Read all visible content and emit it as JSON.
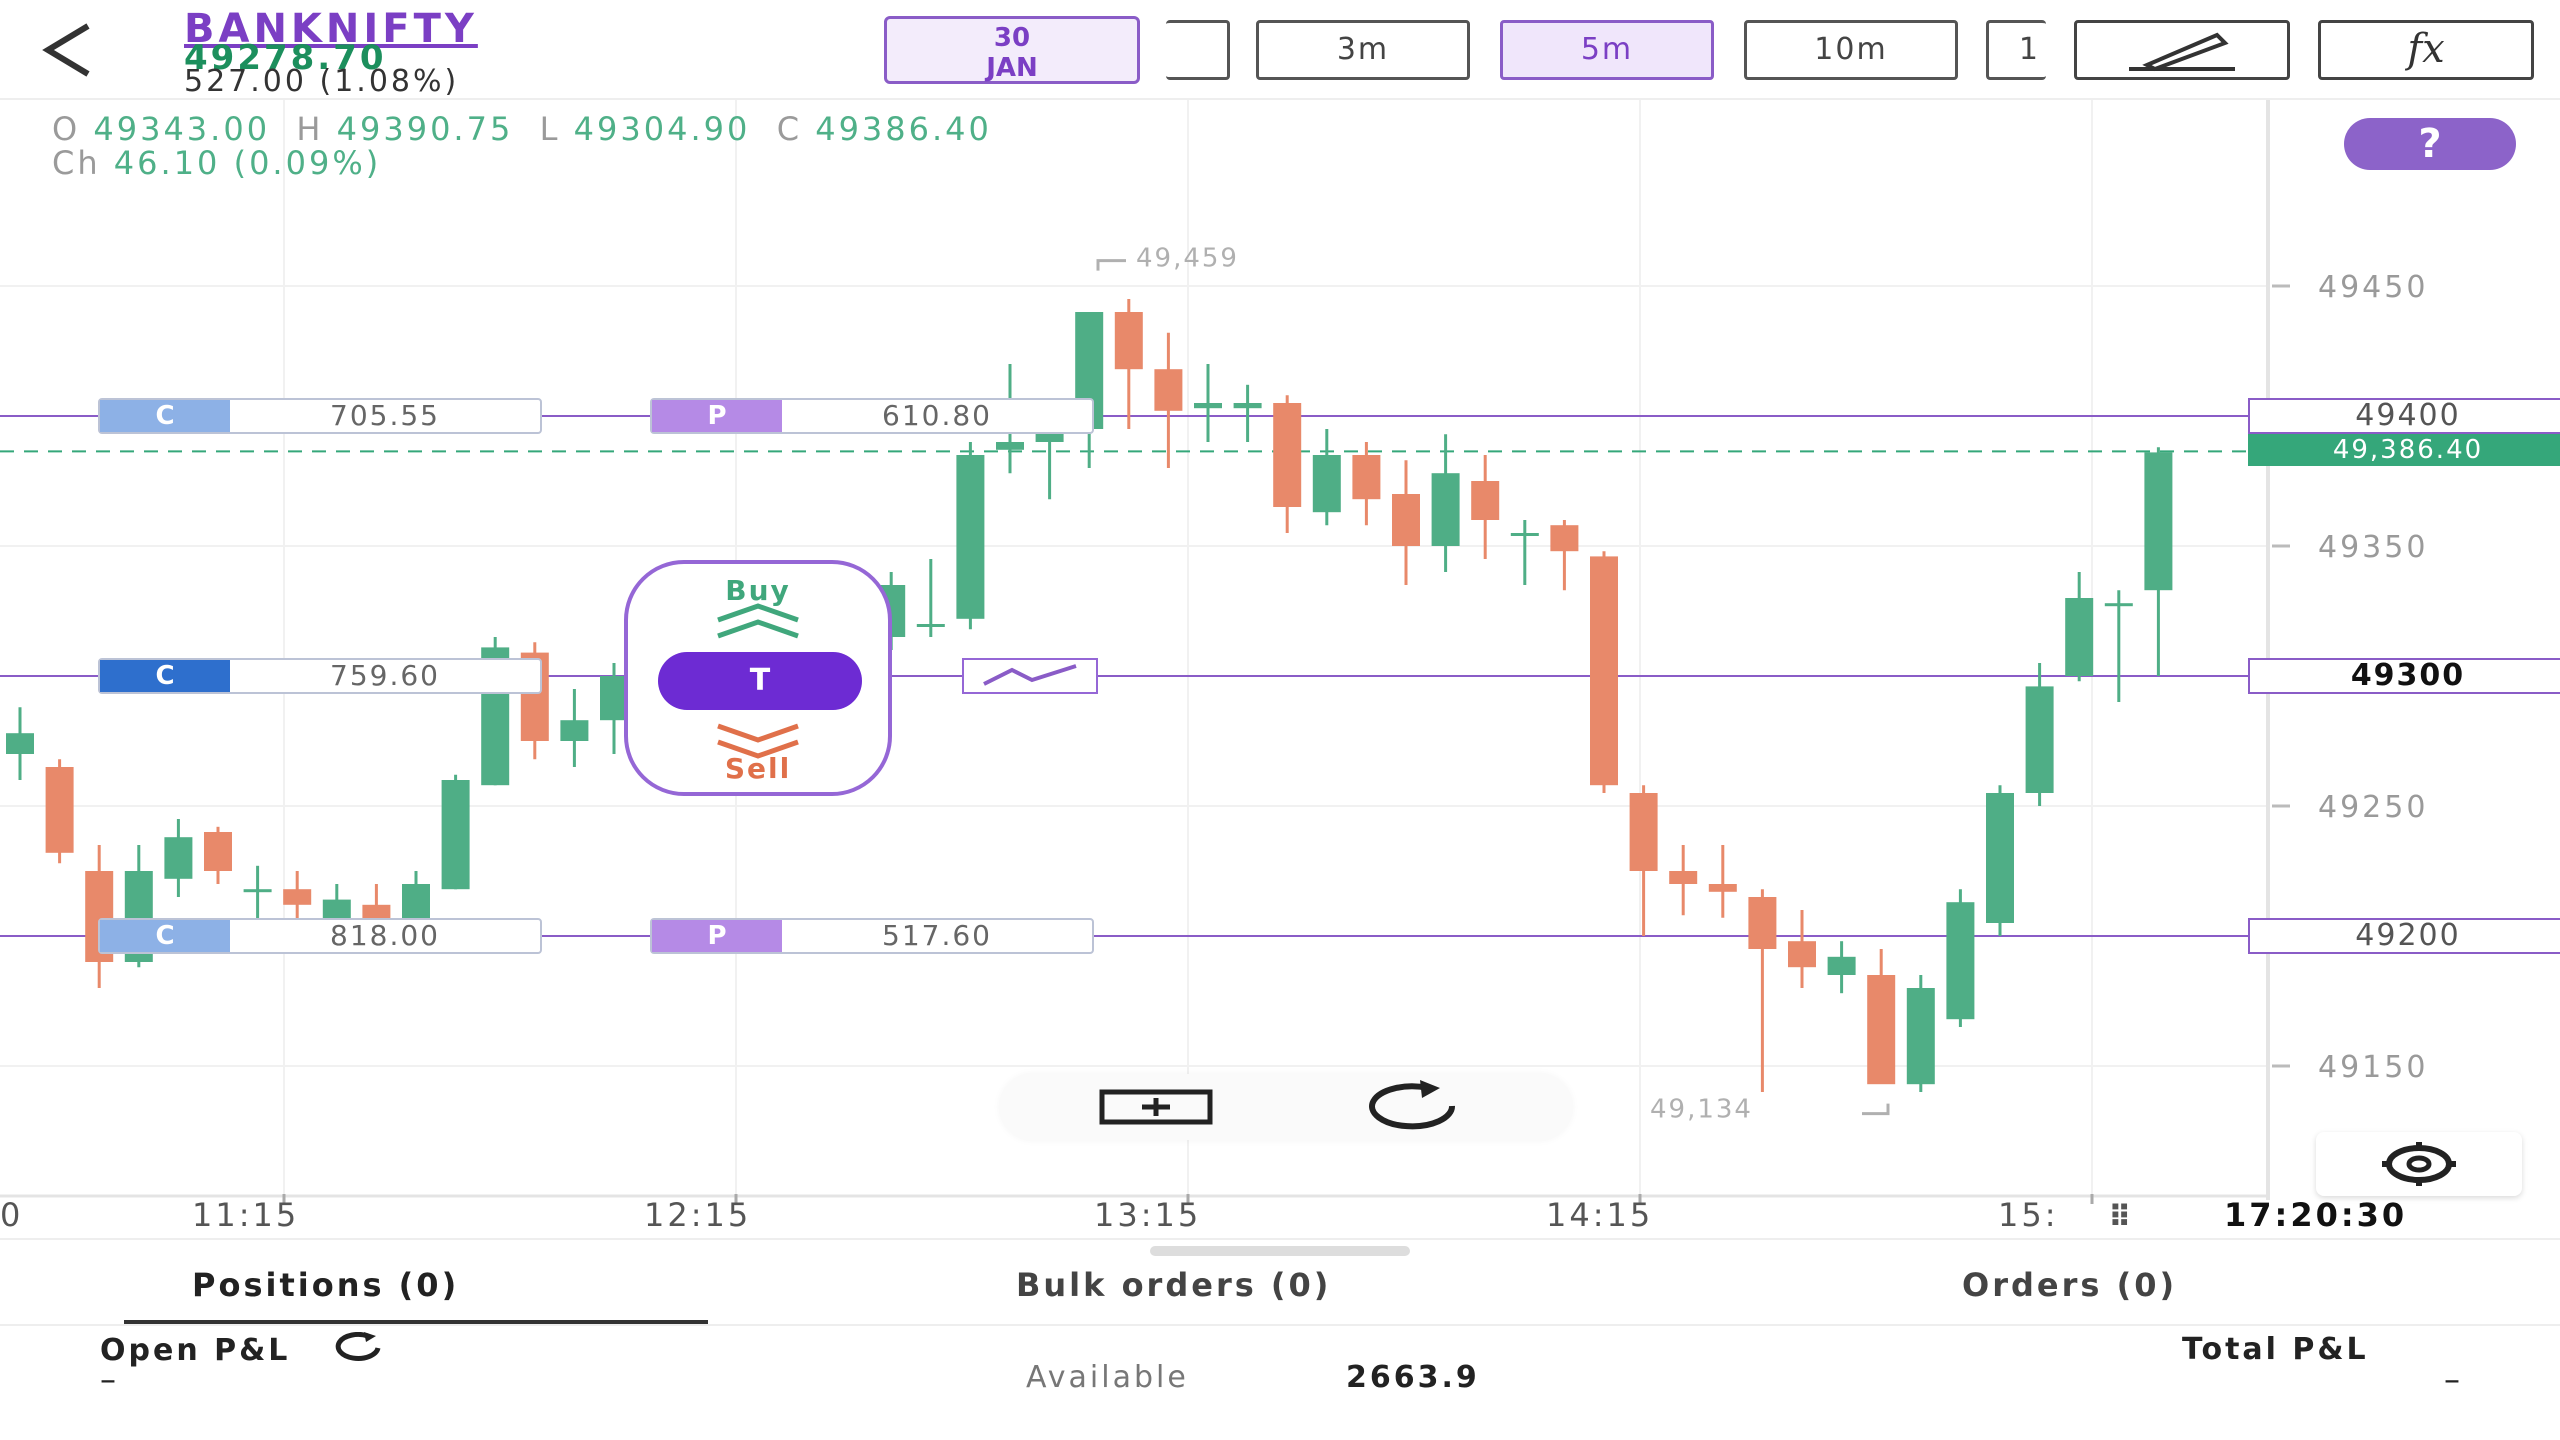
{
  "header": {
    "back_icon": "back-arrow-icon",
    "symbol": "BANKNIFTY",
    "ltp": "49278.70",
    "change": "527.00 (1.08%)",
    "expiry_day": "30",
    "expiry_month": "JAN",
    "timeframes": [
      {
        "label": "",
        "active": false
      },
      {
        "label": "3m",
        "active": false
      },
      {
        "label": "5m",
        "active": true
      },
      {
        "label": "10m",
        "active": false
      },
      {
        "label": "1",
        "active": false
      }
    ],
    "draw_icon": "pencil-draw-icon",
    "indicator_label": "fx",
    "accent": "#7b3fc4"
  },
  "ohlc": {
    "o_label": "O",
    "o": "49343.00",
    "h_label": "H",
    "h": "49390.75",
    "l_label": "L",
    "l": "49304.90",
    "c_label": "C",
    "c": "49386.40",
    "ch_label": "Ch",
    "ch": "46.10 (0.09%)"
  },
  "help_label": "?",
  "option_chips": [
    {
      "type": "C",
      "value": "705.55"
    },
    {
      "type": "P",
      "value": "610.80"
    },
    {
      "type": "C",
      "value": "759.60"
    },
    {
      "type": "C",
      "value": "818.00"
    },
    {
      "type": "P",
      "value": "517.60"
    }
  ],
  "price_tags": {
    "p49400": "49400",
    "ltp": "49,386.40",
    "p49300": "49300",
    "p49200": "49200"
  },
  "trade_widget": {
    "buy_label": "Buy",
    "t_label": "T",
    "sell_label": "Sell"
  },
  "chart_data": {
    "type": "candlestick",
    "y_ticks": [
      49450,
      49400,
      49350,
      49300,
      49250,
      49200,
      49150
    ],
    "ylim": [
      49130,
      49475
    ],
    "x_ticks": [
      "0",
      "11:15",
      "12:15",
      "13:15",
      "14:15",
      "15:"
    ],
    "high_marker": "49,459",
    "low_marker": "49,134",
    "last_price": 49386.4,
    "colors": {
      "up": "#4fae86",
      "down": "#e8896a",
      "level_line": "#8a5cc7",
      "ltp_line": "#35a77a"
    },
    "candles": [
      {
        "o": 49270,
        "h": 49288,
        "l": 49260,
        "c": 49278
      },
      {
        "o": 49265,
        "h": 49268,
        "l": 49228,
        "c": 49232
      },
      {
        "o": 49225,
        "h": 49235,
        "l": 49180,
        "c": 49190
      },
      {
        "o": 49190,
        "h": 49235,
        "l": 49188,
        "c": 49225
      },
      {
        "o": 49222,
        "h": 49245,
        "l": 49215,
        "c": 49238
      },
      {
        "o": 49240,
        "h": 49242,
        "l": 49220,
        "c": 49225
      },
      {
        "o": 49218,
        "h": 49227,
        "l": 49205,
        "c": 49218
      },
      {
        "o": 49218,
        "h": 49225,
        "l": 49205,
        "c": 49212
      },
      {
        "o": 49205,
        "h": 49220,
        "l": 49200,
        "c": 49214
      },
      {
        "o": 49212,
        "h": 49220,
        "l": 49203,
        "c": 49206
      },
      {
        "o": 49205,
        "h": 49225,
        "l": 49203,
        "c": 49220
      },
      {
        "o": 49218,
        "h": 49262,
        "l": 49218,
        "c": 49260
      },
      {
        "o": 49258,
        "h": 49315,
        "l": 49258,
        "c": 49311
      },
      {
        "o": 49309,
        "h": 49313,
        "l": 49268,
        "c": 49275
      },
      {
        "o": 49275,
        "h": 49295,
        "l": 49265,
        "c": 49283
      },
      {
        "o": 49283,
        "h": 49305,
        "l": 49270,
        "c": 49300
      },
      {
        "o": 49300,
        "h": 49325,
        "l": 49295,
        "c": 49318
      },
      {
        "o": 49300,
        "h": 49300,
        "l": 49282,
        "c": 49290
      },
      {
        "o": 49288,
        "h": 49295,
        "l": 49282,
        "c": 49290
      },
      {
        "o": 49320,
        "h": 49330,
        "l": 49300,
        "c": 49328
      },
      {
        "o": 49330,
        "h": 49333,
        "l": 49300,
        "c": 49305
      },
      {
        "o": 49305,
        "h": 49320,
        "l": 49285,
        "c": 49318
      },
      {
        "o": 49315,
        "h": 49340,
        "l": 49310,
        "c": 49335
      },
      {
        "o": 49320,
        "h": 49345,
        "l": 49315,
        "c": 49320
      },
      {
        "o": 49322,
        "h": 49390,
        "l": 49318,
        "c": 49385
      },
      {
        "o": 49387,
        "h": 49420,
        "l": 49378,
        "c": 49390
      },
      {
        "o": 49390,
        "h": 49400,
        "l": 49368,
        "c": 49403
      },
      {
        "o": 49395,
        "h": 49440,
        "l": 49380,
        "c": 49440
      },
      {
        "o": 49440,
        "h": 49445,
        "l": 49395,
        "c": 49418
      },
      {
        "o": 49418,
        "h": 49432,
        "l": 49380,
        "c": 49402
      },
      {
        "o": 49403,
        "h": 49420,
        "l": 49390,
        "c": 49405
      },
      {
        "o": 49403,
        "h": 49412,
        "l": 49390,
        "c": 49405
      },
      {
        "o": 49405,
        "h": 49408,
        "l": 49355,
        "c": 49365
      },
      {
        "o": 49363,
        "h": 49395,
        "l": 49358,
        "c": 49385
      },
      {
        "o": 49385,
        "h": 49390,
        "l": 49358,
        "c": 49368
      },
      {
        "o": 49370,
        "h": 49383,
        "l": 49335,
        "c": 49350
      },
      {
        "o": 49350,
        "h": 49393,
        "l": 49340,
        "c": 49378
      },
      {
        "o": 49375,
        "h": 49385,
        "l": 49345,
        "c": 49360
      },
      {
        "o": 49355,
        "h": 49360,
        "l": 49335,
        "c": 49355
      },
      {
        "o": 49358,
        "h": 49360,
        "l": 49333,
        "c": 49348
      },
      {
        "o": 49346,
        "h": 49348,
        "l": 49255,
        "c": 49258
      },
      {
        "o": 49255,
        "h": 49258,
        "l": 49200,
        "c": 49225
      },
      {
        "o": 49225,
        "h": 49235,
        "l": 49208,
        "c": 49220
      },
      {
        "o": 49220,
        "h": 49235,
        "l": 49207,
        "c": 49217
      },
      {
        "o": 49215,
        "h": 49218,
        "l": 49140,
        "c": 49195
      },
      {
        "o": 49198,
        "h": 49210,
        "l": 49180,
        "c": 49188
      },
      {
        "o": 49185,
        "h": 49198,
        "l": 49178,
        "c": 49192
      },
      {
        "o": 49185,
        "h": 49195,
        "l": 49145,
        "c": 49143
      },
      {
        "o": 49143,
        "h": 49185,
        "l": 49140,
        "c": 49180
      },
      {
        "o": 49168,
        "h": 49218,
        "l": 49165,
        "c": 49213
      },
      {
        "o": 49205,
        "h": 49258,
        "l": 49200,
        "c": 49255
      },
      {
        "o": 49255,
        "h": 49305,
        "l": 49250,
        "c": 49296
      },
      {
        "o": 49300,
        "h": 49340,
        "l": 49298,
        "c": 49330
      },
      {
        "o": 49328,
        "h": 49333,
        "l": 49290,
        "c": 49328
      },
      {
        "o": 49333,
        "h": 49388,
        "l": 49300,
        "c": 49386
      }
    ]
  },
  "timeline": {
    "x_labels": [
      "0",
      "11:15",
      "12:15",
      "13:15",
      "14:15",
      "15:"
    ],
    "clock": "17:20:30",
    "handle_icon": "drag-handle-icon"
  },
  "floating_controls": {
    "fit_icon": "fit-screen-icon",
    "refresh_icon": "refresh-icon",
    "settings_icon": "gear-icon"
  },
  "panel": {
    "tabs": [
      {
        "label": "Positions (0)",
        "active": true
      },
      {
        "label": "Bulk orders (0)",
        "active": false
      },
      {
        "label": "Orders (0)",
        "active": false
      }
    ],
    "open_pnl_label": "Open P&L",
    "open_pnl_value": "–",
    "available_label": "Available",
    "available_value": "2663.9",
    "total_pnl_label": "Total P&L",
    "total_pnl_value": "–",
    "refresh_icon": "refresh-icon"
  }
}
